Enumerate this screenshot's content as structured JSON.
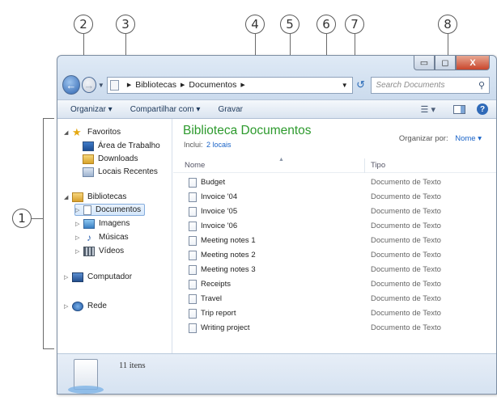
{
  "callouts": [
    "1",
    "2",
    "3",
    "4",
    "5",
    "6",
    "7",
    "8"
  ],
  "window": {
    "caption_buttons": {
      "minimize": "▭",
      "maximize": "◻",
      "close": "X"
    },
    "address": {
      "breadcrumb": [
        "Bibliotecas",
        "Documentos"
      ],
      "dropdown": "▼",
      "refresh": "↺"
    },
    "search": {
      "placeholder": "Search Documents",
      "icon": "search-icon"
    },
    "commands": [
      "Organizar ▾",
      "Compartilhar com ▾",
      "Gravar"
    ],
    "help_label": "?"
  },
  "nav_pane": {
    "favorites": {
      "label": "Favoritos",
      "items": [
        "Área de Trabalho",
        "Downloads",
        "Locais Recentes"
      ]
    },
    "libraries": {
      "label": "Bibliotecas",
      "items": [
        "Documentos",
        "Imagens",
        "Músicas",
        "Vídeos"
      ],
      "selected": "Documentos"
    },
    "computer": "Computador",
    "network": "Rede"
  },
  "library": {
    "title": "Biblioteca Documentos",
    "includes_label": "Inclui:",
    "includes_link": "2 locais",
    "arrange_label": "Organizar por:",
    "arrange_value": "Nome ▾"
  },
  "columns": {
    "name": "Nome",
    "type": "Tipo"
  },
  "files": [
    {
      "name": "Budget",
      "type": "Documento de Texto"
    },
    {
      "name": "Invoice '04",
      "type": "Documento de Texto"
    },
    {
      "name": "Invoice '05",
      "type": "Documento de Texto"
    },
    {
      "name": "Invoice '06",
      "type": "Documento de Texto"
    },
    {
      "name": "Meeting notes 1",
      "type": "Documento de Texto"
    },
    {
      "name": "Meeting notes 2",
      "type": "Documento de Texto"
    },
    {
      "name": "Meeting notes 3",
      "type": "Documento de Texto"
    },
    {
      "name": "Receipts",
      "type": "Documento de Texto"
    },
    {
      "name": "Travel",
      "type": "Documento de Texto"
    },
    {
      "name": "Trip report",
      "type": "Documento de Texto"
    },
    {
      "name": "Writing project",
      "type": "Documento de Texto"
    }
  ],
  "details": {
    "count": "11 itens"
  },
  "colors": {
    "library_title": "#2d9a2d",
    "link": "#1a64c8",
    "selection": "#d4e7fb"
  }
}
